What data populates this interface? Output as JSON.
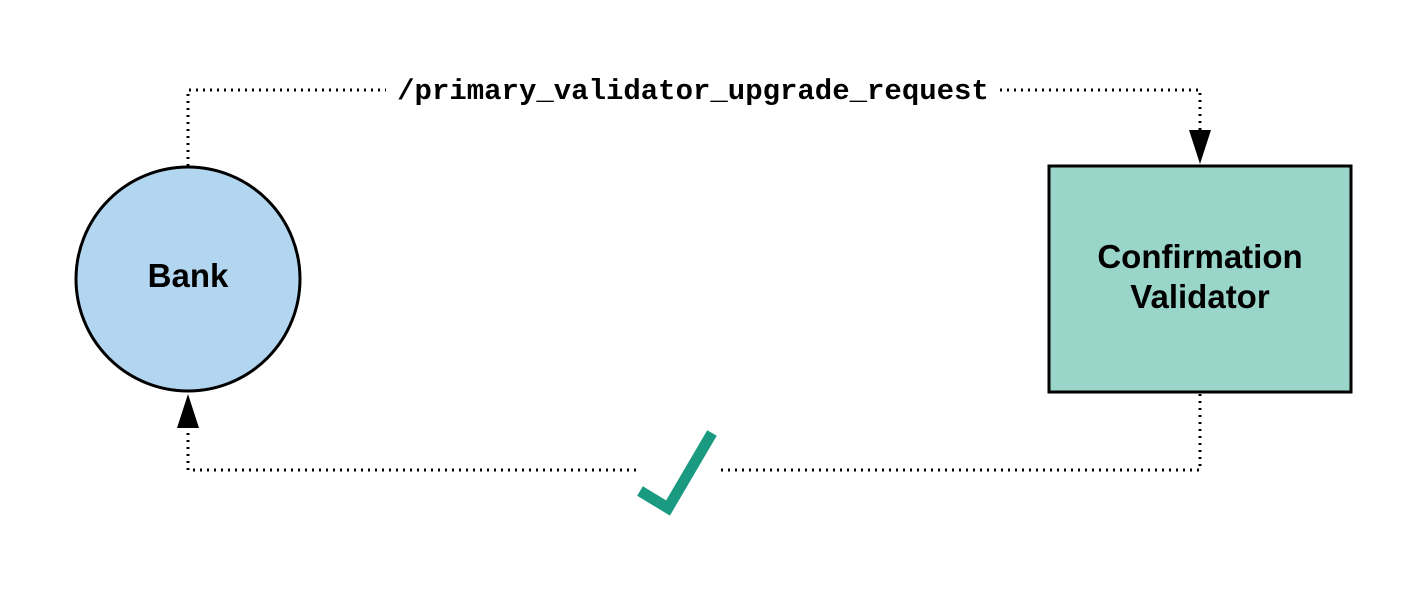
{
  "nodes": {
    "bank": {
      "label": "Bank",
      "color": "#b3d6f0"
    },
    "confirmation_validator": {
      "label_line1": "Confirmation",
      "label_line2": "Validator",
      "color": "#9ad5ca"
    }
  },
  "edges": {
    "upgrade_request": {
      "label": "/primary_validator_upgrade_request"
    },
    "response": {
      "icon": "checkmark-icon",
      "icon_color": "#1a9a80"
    }
  }
}
